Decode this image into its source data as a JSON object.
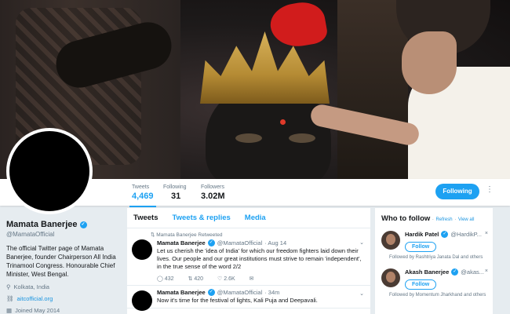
{
  "profile": {
    "name": "Mamata Banerjee",
    "handle": "@MamataOfficial",
    "bio": "The official Twitter page of Mamata Banerjee, founder Chairperson All India Trinamool Congress. Honourable Chief Minister, West Bengal.",
    "location": "Kolkata, India",
    "website": "aitcofficial.org",
    "joined": "Joined May 2014"
  },
  "stats": [
    {
      "label": "Tweets",
      "value": "4,469"
    },
    {
      "label": "Following",
      "value": "31"
    },
    {
      "label": "Followers",
      "value": "3.02M"
    }
  ],
  "nav": {
    "following_label": "Following",
    "more_icon": "⋮"
  },
  "tabs": [
    {
      "label": "Tweets"
    },
    {
      "label": "Tweets & replies"
    },
    {
      "label": "Media"
    }
  ],
  "tweets": [
    {
      "retweet_note": "Mamata Banerjee Retweeted",
      "name": "Mamata Banerjee",
      "handle": "@MamataOfficial",
      "time": "· Aug 14",
      "text": "Let us cherish the 'idea of India' for which our freedom fighters laid down their lives. Our people and our great institutions must strive to remain 'independent', in the true sense of the word 2/2",
      "replies": "432",
      "retweets": "420",
      "likes": "2.6K"
    },
    {
      "name": "Mamata Banerjee",
      "handle": "@MamataOfficial",
      "time": "· 34m",
      "text": "Now it's time for the festival of lights, Kali Puja and Deepavali."
    }
  ],
  "who_to_follow": {
    "title": "Who to follow",
    "refresh": "Refresh",
    "view_all": "View all",
    "sep": "·",
    "suggestions": [
      {
        "name": "Hardik Patel",
        "handle": "@HardikP...",
        "follow": "Follow",
        "note": "Followed by Rashtriya Janata Dal and others"
      },
      {
        "name": "Akash Banerjee",
        "handle": "@akas...",
        "follow": "Follow",
        "note": "Followed by Momentum Jharkhand and others"
      }
    ]
  },
  "colors": {
    "accent": "#1da1f2",
    "link": "#1b95e0",
    "muted": "#657786",
    "background": "#e6ecf0"
  }
}
